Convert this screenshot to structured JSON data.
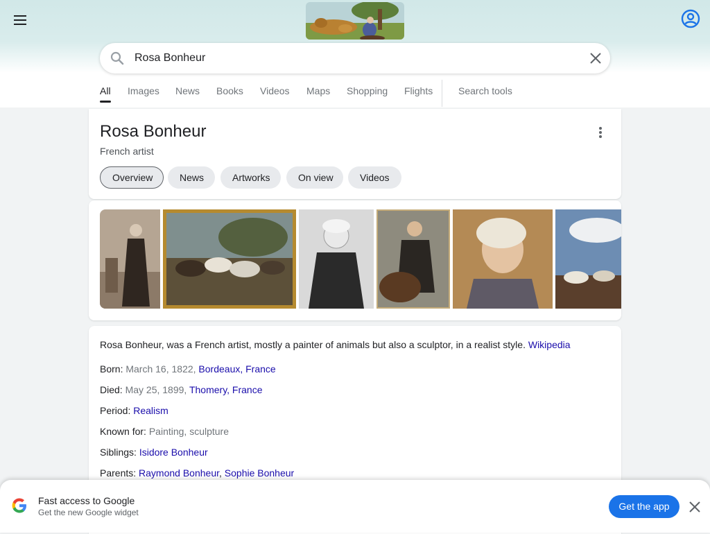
{
  "search": {
    "query": "Rosa Bonheur",
    "icons": {
      "menu": "menu-icon",
      "search": "search-icon",
      "clear": "close-icon",
      "account": "account-circle-icon"
    }
  },
  "tabs": [
    {
      "label": "All",
      "active": true
    },
    {
      "label": "Images"
    },
    {
      "label": "News"
    },
    {
      "label": "Books"
    },
    {
      "label": "Videos"
    },
    {
      "label": "Maps"
    },
    {
      "label": "Shopping"
    },
    {
      "label": "Flights"
    }
  ],
  "search_tools_label": "Search tools",
  "knowledge_panel": {
    "title": "Rosa Bonheur",
    "subtitle": "French artist",
    "chips": [
      {
        "label": "Overview",
        "selected": true
      },
      {
        "label": "News"
      },
      {
        "label": "Artworks"
      },
      {
        "label": "On view"
      },
      {
        "label": "Videos"
      }
    ],
    "description": "Rosa Bonheur, was a French artist, mostly a painter of animals but also a sculptor, in a realist style.",
    "source_link": "Wikipedia",
    "facts": {
      "born": {
        "label": "Born:",
        "text": "March 16, 1822,",
        "link": "Bordeaux, France"
      },
      "died": {
        "label": "Died:",
        "text": "May 25, 1899,",
        "link": "Thomery, France"
      },
      "period": {
        "label": "Period:",
        "link": "Realism"
      },
      "known_for": {
        "label": "Known for:",
        "text": "Painting, sculpture"
      },
      "siblings": {
        "label": "Siblings:",
        "link": "Isidore Bonheur"
      },
      "parents": {
        "label": "Parents:",
        "link1": "Raymond Bonheur",
        "sep": ",",
        "link2": "Sophie Bonheur"
      }
    }
  },
  "banner": {
    "title": "Fast access to Google",
    "subtitle": "Get the new Google widget",
    "button": "Get the app"
  },
  "colors": {
    "link": "#1a0dab",
    "accent": "#1a73e8",
    "chip_bg": "#e8eaed"
  }
}
